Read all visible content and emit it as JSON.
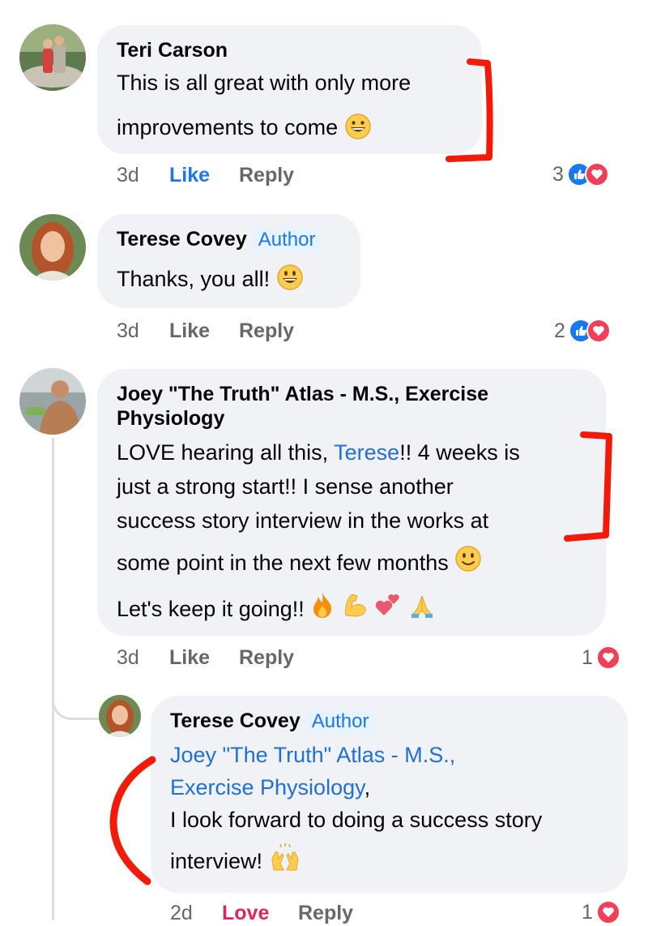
{
  "comments": [
    {
      "author": "Teri Carson",
      "lines": [
        "This is all great with only more",
        "improvements to come"
      ],
      "time": "3d",
      "like_label": "Like",
      "reply_label": "Reply",
      "reaction_count": "3",
      "reactions": [
        "like-icon",
        "love-icon"
      ]
    },
    {
      "author": "Terese Covey",
      "badge": "Author",
      "lines": [
        "Thanks, you all!"
      ],
      "time": "3d",
      "like_label": "Like",
      "reply_label": "Reply",
      "reaction_count": "2",
      "reactions": [
        "like-icon",
        "love-icon"
      ]
    },
    {
      "author_line1": "Joey \"The Truth\" Atlas - M.S., Exercise",
      "author_line2": "Physiology",
      "line1_pre": "LOVE hearing all this, ",
      "line1_mention": "Terese",
      "line1_post": "!!  4 weeks is",
      "line2": "just a strong start!! I sense another",
      "line3": "success story interview in the works at",
      "line4": "some point in the next few months",
      "line5": "Let's keep it going!!",
      "time": "3d",
      "like_label": "Like",
      "reply_label": "Reply",
      "reaction_count": "1",
      "reactions": [
        "love-icon"
      ]
    },
    {
      "author": "Terese Covey",
      "badge": "Author",
      "mention_line1": "Joey \"The Truth\" Atlas - M.S.,",
      "mention_line2": "Exercise Physiology",
      "mention_suffix": ",",
      "line3": "I look forward to doing a success story",
      "line4": "interview!",
      "time": "2d",
      "like_label": "Love",
      "reply_label": "Reply",
      "reaction_count": "1",
      "reactions": [
        "love-icon"
      ]
    }
  ],
  "colors": {
    "bubble": "#f0f2f5",
    "link": "#216fdb",
    "love": "#e0245e",
    "like": "#1877f2",
    "markup_red": "#f21b0a"
  }
}
